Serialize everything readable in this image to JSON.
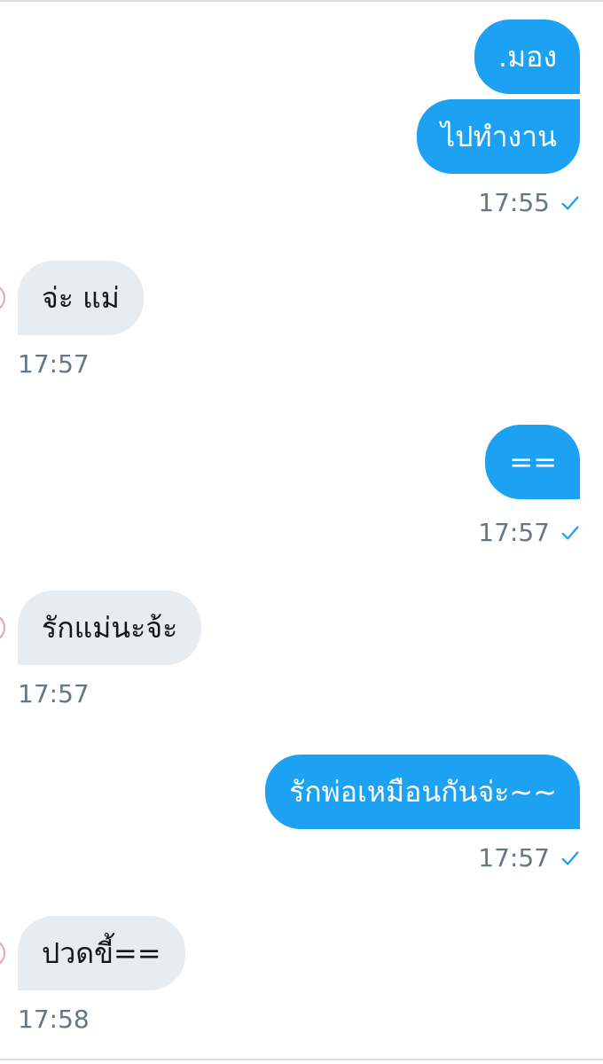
{
  "conversation": {
    "messages": [
      {
        "direction": "outgoing",
        "text": ".มอง"
      },
      {
        "direction": "outgoing",
        "text": "ไปทำงาน"
      },
      {
        "direction": "incoming",
        "text": "จ่ะ แม่"
      },
      {
        "direction": "outgoing",
        "text": "=="
      },
      {
        "direction": "incoming",
        "text": "รักแม่นะจ้ะ"
      },
      {
        "direction": "outgoing",
        "text": "รักพ่อเหมือนกันจ่ะ~~"
      },
      {
        "direction": "incoming",
        "text": "ปวดขี้=="
      }
    ],
    "timestamps": [
      "17:55",
      "17:57",
      "17:57",
      "17:57",
      "17:57",
      "17:57",
      "17:58"
    ]
  },
  "colors": {
    "outgoing_bubble": "#1da1f2",
    "incoming_bubble": "#e6ecf0",
    "timestamp_text": "#657786",
    "read_check": "#1da1f2"
  },
  "icons": {
    "read_receipt": "check-icon",
    "sender_avatar": "avatar"
  }
}
